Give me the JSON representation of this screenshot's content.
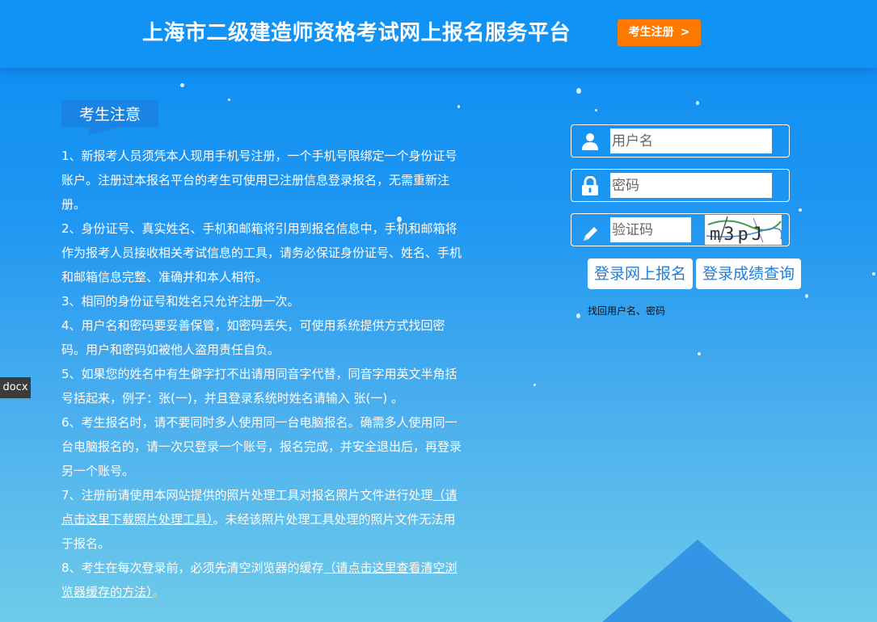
{
  "header": {
    "title": "上海市二级建造师资格考试网上报名服务平台",
    "register_button": {
      "label": "考生注册",
      "chevron": ">"
    }
  },
  "notice": {
    "title": "考生注意",
    "items": [
      "1、新报考人员须凭本人现用手机号注册，一个手机号限绑定一个身份证号账户。注册过本报名平台的考生可使用已注册信息登录报名，无需重新注册。",
      "2、身份证号、真实姓名、手机和邮箱将引用到报名信息中，手机和邮箱将作为报考人员接收相关考试信息的工具，请务必保证身份证号、姓名、手机和邮箱信息完整、准确并和本人相符。",
      "3、相同的身份证号和姓名只允许注册一次。",
      "4、用户名和密码要妥善保管，如密码丢失，可使用系统提供方式找回密码。用户和密码如被他人盗用责任自负。",
      "5、如果您的姓名中有生僻字打不出请用同音字代替，同音字用英文半角括号括起来，例子：张(一)，并且登录系统时姓名请输入 张(一) 。"
    ],
    "item6": "6、考生报名时，请不要同时多人使用同一台电脑报名。确需多人使用同一台电脑报名的，请一次只登录一个账号，报名完成，并安全退出后，再登录另一个账号。",
    "item7": {
      "prefix": "7、注册前请使用本网站提供的照片处理工具对报名照片文件进行处理",
      "link": "（请点击这里下载照片处理工具）",
      "suffix": "。未经该照片处理工具处理的照片文件无法用于报名。"
    },
    "item8": {
      "prefix": "8、考生在每次登录前，必须先清空浏览器的缓存",
      "link": "（请点击这里查看清空浏览器缓存的方法）",
      "suffix": "。"
    }
  },
  "side_tag": "docx",
  "login": {
    "username_placeholder": "用户名",
    "password_placeholder": "密码",
    "captcha_placeholder": "验证码",
    "captcha_text": "m3pJ",
    "login_button": "登录网上报名",
    "score_button": "登录成绩查询",
    "find_link": "找回用户名、密码"
  },
  "icons": {
    "user": "user-icon",
    "lock": "lock-icon",
    "pencil": "pencil-icon",
    "chevron": "chevron-right-icon"
  },
  "colors": {
    "accent": "#ff7a00",
    "header": "#1192f5",
    "button_text": "#1a7fde"
  }
}
